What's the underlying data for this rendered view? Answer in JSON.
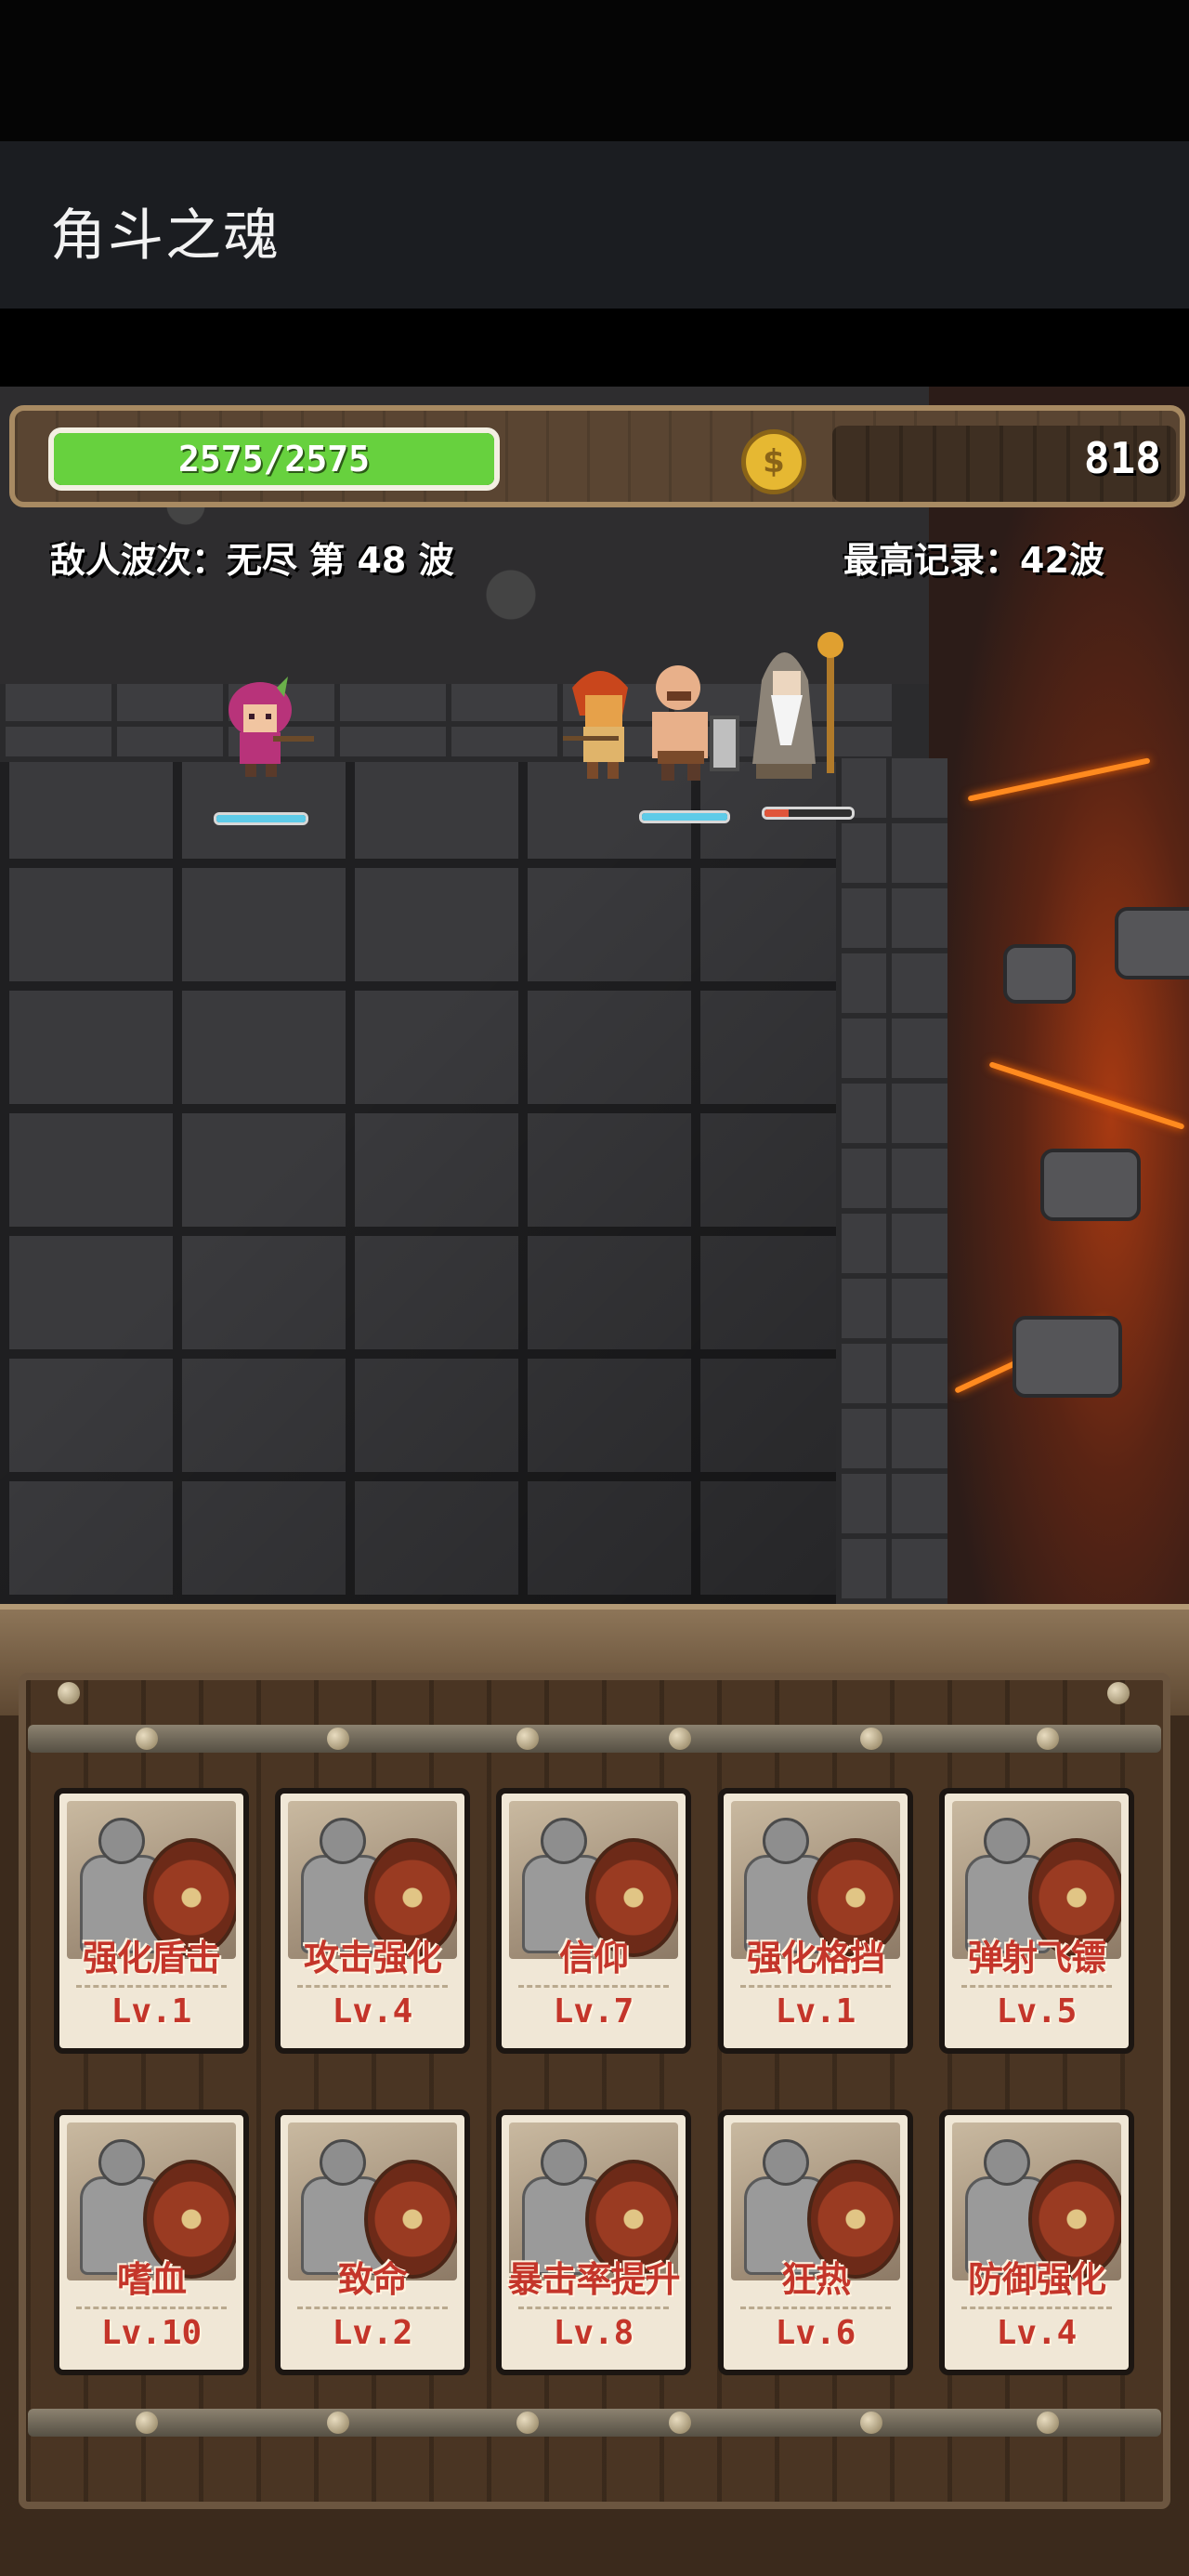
{
  "app": {
    "title": "角斗之魂"
  },
  "hud": {
    "hp_text": "2575/2575",
    "hp_fraction": 1.0,
    "coin_count": "818",
    "wave_text": "敌人波次：无尽 第 48 波",
    "record_text": "最高记录：42波"
  },
  "colors": {
    "hp": "#67d13e",
    "card_text": "#c4352a",
    "coin": "#e6b832"
  },
  "cards": [
    {
      "name": "强化盾击",
      "level": "Lv.1"
    },
    {
      "name": "攻击强化",
      "level": "Lv.4"
    },
    {
      "name": "信仰",
      "level": "Lv.7"
    },
    {
      "name": "强化格挡",
      "level": "Lv.1"
    },
    {
      "name": "弹射飞镖",
      "level": "Lv.5"
    },
    {
      "name": "嗜血",
      "level": "Lv.10"
    },
    {
      "name": "致命",
      "level": "Lv.2"
    },
    {
      "name": "暴击率提升",
      "level": "Lv.8"
    },
    {
      "name": "狂热",
      "level": "Lv.6"
    },
    {
      "name": "防御强化",
      "level": "Lv.4"
    }
  ]
}
